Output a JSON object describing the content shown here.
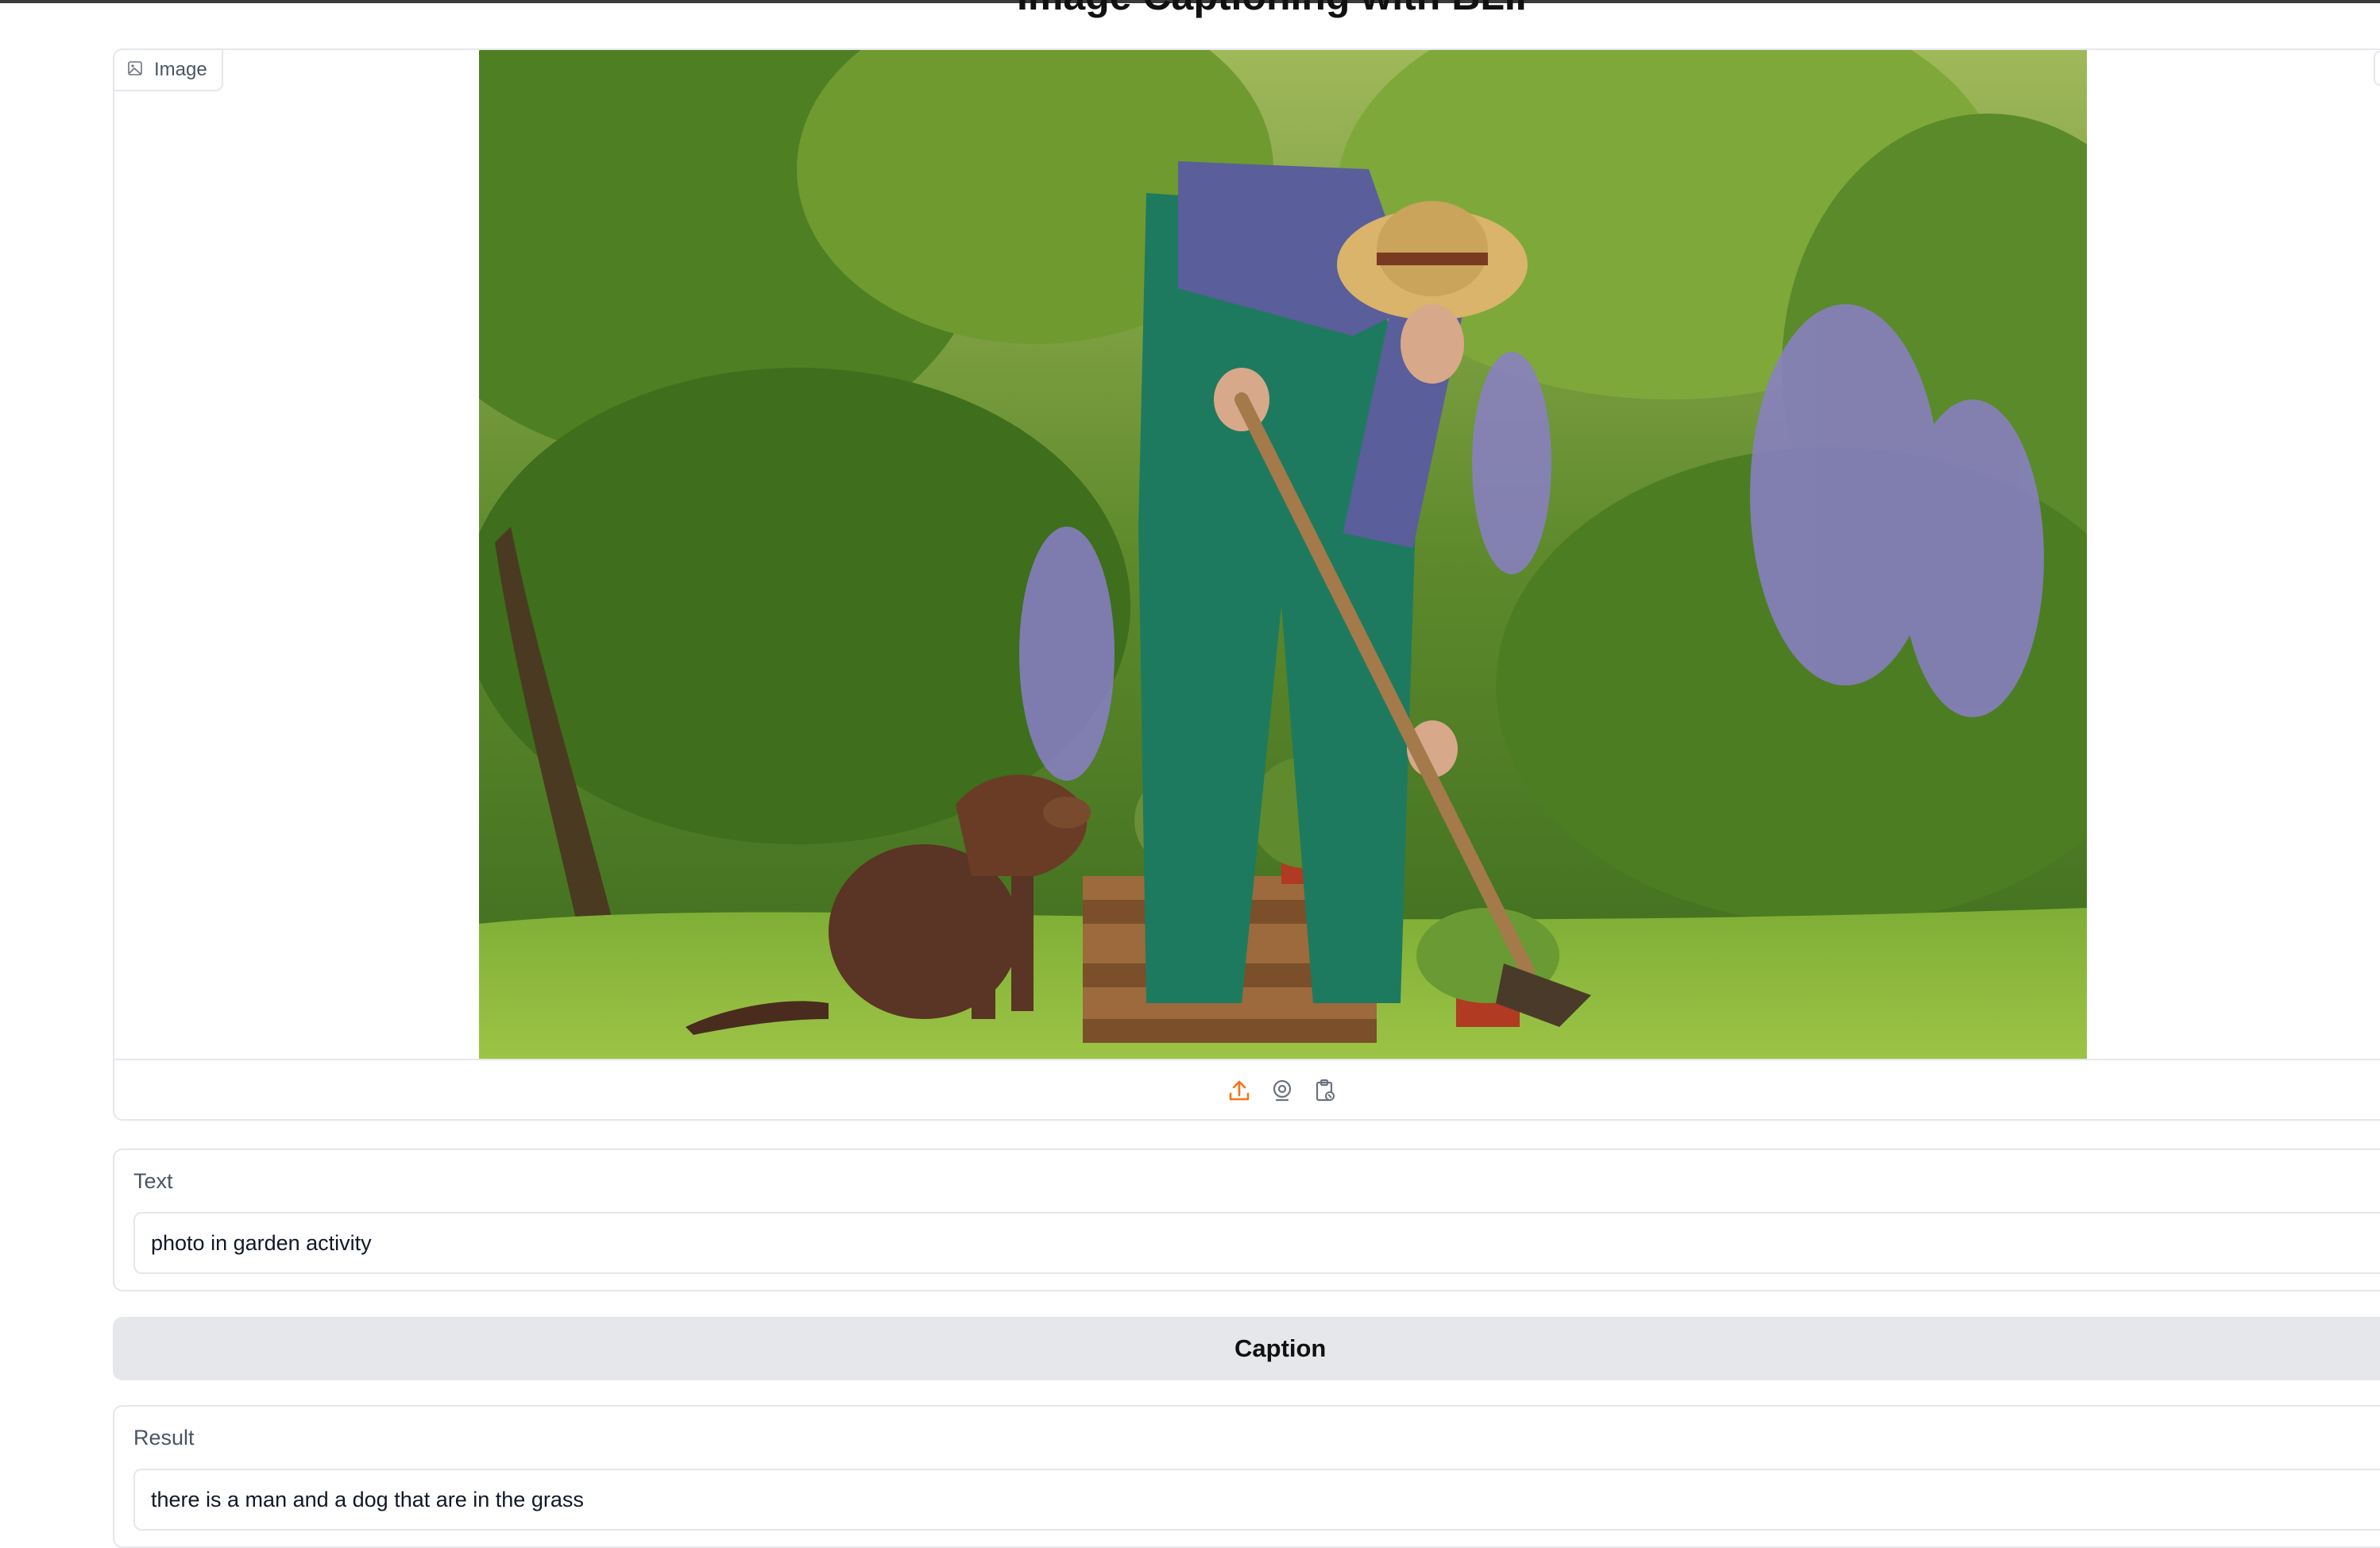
{
  "page": {
    "title": "Image Captioning with BLIP"
  },
  "image_input": {
    "label": "Image",
    "label_icon": "image-icon",
    "sources": [
      "upload-icon",
      "webcam-icon",
      "clipboard-icon"
    ],
    "accent_color": "#f97316"
  },
  "text_input": {
    "label": "Text",
    "value": "photo in garden activity"
  },
  "caption_button": {
    "label": "Caption"
  },
  "result": {
    "label": "Result",
    "value": "there is a man and a dog that are in the grass"
  }
}
